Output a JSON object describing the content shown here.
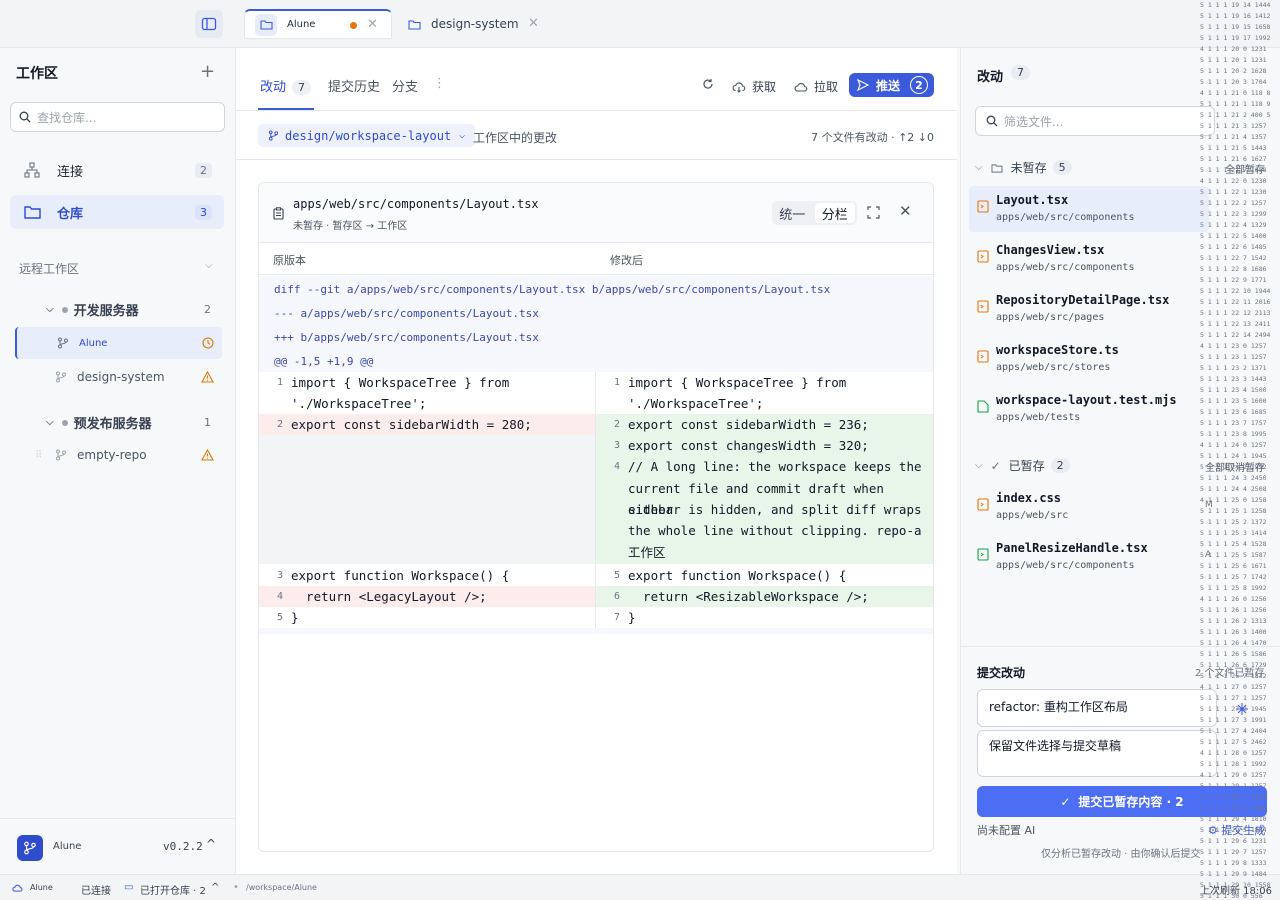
{
  "window": {
    "tabs": [
      {
        "label": "Alune",
        "active": true,
        "modified": true
      },
      {
        "label": "design-system",
        "active": false
      }
    ]
  },
  "sidebar": {
    "title": "工作区",
    "search_placeholder": "查找仓库...",
    "nav": [
      {
        "label": "连接",
        "count": "2"
      },
      {
        "label": "仓库",
        "count": "3",
        "selected": true
      }
    ],
    "remote_title": "远程工作区",
    "servers": [
      {
        "name": "开发服务器",
        "count": "2",
        "repos": [
          {
            "name": "Alune",
            "status": "clock-icon",
            "selected": true
          },
          {
            "name": "design-system",
            "status": "warning-icon"
          }
        ]
      },
      {
        "name": "预发布服务器",
        "count": "1",
        "repos": [
          {
            "name": "empty-repo",
            "status": "warning-icon"
          }
        ]
      }
    ],
    "user": {
      "name": "Alune",
      "version": "v0.2.2"
    }
  },
  "center": {
    "tabs": [
      {
        "label": "改动",
        "count": "7",
        "active": true
      },
      {
        "label": "提交历史"
      },
      {
        "label": "分支"
      }
    ],
    "actions": {
      "fetch": "获取",
      "pull": "拉取",
      "push": "推送",
      "push_count": "2"
    },
    "branch": "design/workspace-layout",
    "wc_label": "工作区中的更改",
    "file_stat": "7 个文件有改动 · ↑2 ↓0",
    "diff": {
      "path": "apps/web/src/components/Layout.tsx",
      "sub": "未暂存 · 暂存区 → 工作区",
      "mode_unified": "统一",
      "mode_split": "分栏",
      "col_old": "原版本",
      "col_new": "修改后",
      "meta": [
        "diff --git a/apps/web/src/components/Layout.tsx b/apps/web/src/components/Layout.tsx",
        "--- a/apps/web/src/components/Layout.tsx",
        "+++ b/apps/web/src/components/Layout.tsx",
        "@@ -1,5 +1,9 @@"
      ],
      "left": [
        {
          "n": "1",
          "l1": "import { WorkspaceTree } from",
          "l2": "'./WorkspaceTree';"
        },
        {
          "n": "2",
          "l1": "export const sidebarWidth = 280;"
        },
        {
          "n": "3",
          "l1": "export function Workspace() {"
        },
        {
          "n": "4",
          "l1": "  return <LegacyLayout />;"
        },
        {
          "n": "5",
          "l1": "}"
        }
      ],
      "right": [
        {
          "n": "1",
          "l1": "import { WorkspaceTree } from",
          "l2": "'./WorkspaceTree';"
        },
        {
          "n": "2",
          "l1": "export const sidebarWidth = 236;"
        },
        {
          "n": "3",
          "l1": "export const changesWidth = 320;"
        },
        {
          "n": "4",
          "l1": "// A long line: the workspace keeps the",
          "l2": "current file and commit draft when either",
          "l3": "sidebar is hidden, and split diff wraps",
          "l4": "the whole line without clipping. repo-a ·",
          "l5": "工作区"
        },
        {
          "n": "5",
          "l1": "export function Workspace() {"
        },
        {
          "n": "6",
          "l1": "  return <ResizableWorkspace />;"
        },
        {
          "n": "7",
          "l1": "}"
        }
      ]
    }
  },
  "changes": {
    "title": "改动",
    "count": "7",
    "filter_placeholder": "筛选文件...",
    "unstaged": {
      "label": "未暂存",
      "count": "5",
      "action": "全部暂存",
      "files": [
        {
          "name": "Layout.tsx",
          "path": "apps/web/src/components",
          "selected": true
        },
        {
          "name": "ChangesView.tsx",
          "path": "apps/web/src/components"
        },
        {
          "name": "RepositoryDetailPage.tsx",
          "path": "apps/web/src/pages"
        },
        {
          "name": "workspaceStore.ts",
          "path": "apps/web/src/stores"
        },
        {
          "name": "workspace-layout.test.mjs",
          "path": "apps/web/tests"
        }
      ]
    },
    "staged": {
      "label": "已暂存",
      "count": "2",
      "action": "全部取消暂存",
      "files": [
        {
          "name": "index.css",
          "path": "apps/web/src",
          "state": "M"
        },
        {
          "name": "PanelResizeHandle.tsx",
          "path": "apps/web/src/components",
          "state": "A"
        }
      ]
    },
    "commit": {
      "title": "提交改动",
      "meta": "2 个文件已暂存",
      "summary": "refactor: 重构工作区布局",
      "body": "保留文件选择与提交草稿",
      "button": "提交已暂存内容 · 2",
      "no_ai": "尚未配置 AI",
      "ai_gen": "提交生成",
      "hint": "仅分析已暂存改动 · 由你确认后提交"
    }
  },
  "status": {
    "user": "Alune",
    "connected": "已连接",
    "repos_open": "已打开仓库 · 2",
    "path": "/workspace/Alune",
    "refresh": "上次刷新 18:06"
  },
  "debug_rows": [
    "5 1 1 1 19 14 1444",
    "5 1 1 1 19 16 1412",
    "5 1 1 1 19 15 1658",
    "5 1 1 1 19 17 1992",
    "4 1 1 1 20 0 1231",
    "5 1 1 1 20 1 1231",
    "5 1 1 1 20 2 1628",
    "5 1 1 1 20 3 1704",
    "4 1 1 1 21 0 118 8",
    "5 1 1 1 21 1 118 9",
    "5 1 1 1 21 2 400 5",
    "5 1 1 1 21 3 1257",
    "5 1 1 1 21 4 1357",
    "5 1 1 1 21 5 1443",
    "5 1 1 1 21 6 1627",
    "5 1 1 1 21 7 1658",
    "4 1 1 1 22 0 1230",
    "5 1 1 1 22 1 1230",
    "5 1 1 1 22 2 1257",
    "5 1 1 1 22 3 1299",
    "5 1 1 1 22 4 1329",
    "5 1 1 1 22 5 1400",
    "5 1 1 1 22 6 1485",
    "5 1 1 1 22 7 1542",
    "5 1 1 1 22 8 1686",
    "5 1 1 1 22 9 1771",
    "5 1 1 1 22 10 1944",
    "5 1 1 1 22 11 2016",
    "5 1 1 1 22 12 2113",
    "5 1 1 1 22 13 2411",
    "5 1 1 1 22 14 2494",
    "4 1 1 1 23 0 1257",
    "5 1 1 1 23 1 1257",
    "5 1 1 1 23 2 1371",
    "5 1 1 1 23 3 1443",
    "5 1 1 1 23 4 1500",
    "5 1 1 1 23 5 1600",
    "5 1 1 1 23 6 1685",
    "5 1 1 1 23 7 1757",
    "5 1 1 1 23 8 1995",
    "4 1 1 1 24 0 1257",
    "5 1 1 1 24 1 1945",
    "5 1 1 1 24 2 1992",
    "5 1 1 1 24 3 2450",
    "5 1 1 1 24 4 2508",
    "4 1 1 1 25 0 1258",
    "5 1 1 1 25 1 1258",
    "5 1 1 1 25 2 1372",
    "5 1 1 1 25 3 1414",
    "5 1 1 1 25 4 1528",
    "5 1 1 1 25 5 1587",
    "5 1 1 1 25 6 1671",
    "5 1 1 1 25 7 1742",
    "5 1 1 1 25 8 1992",
    "4 1 1 1 26 0 1256",
    "5 1 1 1 26 1 1256",
    "5 1 1 1 26 2 1313",
    "5 1 1 1 26 3 1400",
    "5 1 1 1 26 4 1470",
    "5 1 1 1 26 5 1586",
    "5 1 1 1 26 6 1729",
    "5 1 1 1 26 7 1832",
    "4 1 1 1 27 0 1257",
    "5 1 1 1 27 1 1257",
    "5 1 1 1 27 2 1945",
    "5 1 1 1 27 3 1991",
    "5 1 1 1 27 4 2404",
    "5 1 1 1 27 5 2462",
    "4 1 1 1 28 0 1257",
    "5 1 1 1 28 1 1992",
    "4 1 1 1 29 0 1257",
    "5 1 1 1 29 1 1257",
    "5 1 1 1 29 2 1333",
    "5 1 1 1 29 3 1400",
    "5 1 1 1 29 4 1810",
    "5 1 1 1 29 5 1884",
    "5 1 1 1 29 6 1231",
    "5 1 1 1 29 7 1257",
    "5 1 1 1 29 8 1333",
    "5 1 1 1 29 9 1484",
    "5 1 1 1 29 10 1558",
    "5 1 1 1 30 0 556"
  ]
}
